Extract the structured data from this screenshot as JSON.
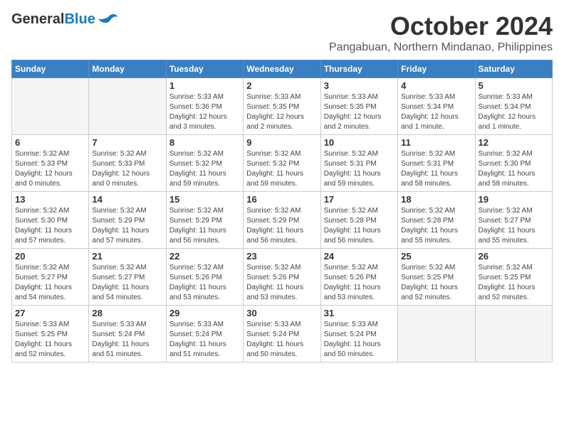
{
  "logo": {
    "line1": "General",
    "line2": "Blue"
  },
  "title": "October 2024",
  "location": "Pangabuan, Northern Mindanao, Philippines",
  "headers": [
    "Sunday",
    "Monday",
    "Tuesday",
    "Wednesday",
    "Thursday",
    "Friday",
    "Saturday"
  ],
  "weeks": [
    [
      {
        "day": "",
        "info": ""
      },
      {
        "day": "",
        "info": ""
      },
      {
        "day": "1",
        "info": "Sunrise: 5:33 AM\nSunset: 5:36 PM\nDaylight: 12 hours\nand 3 minutes."
      },
      {
        "day": "2",
        "info": "Sunrise: 5:33 AM\nSunset: 5:35 PM\nDaylight: 12 hours\nand 2 minutes."
      },
      {
        "day": "3",
        "info": "Sunrise: 5:33 AM\nSunset: 5:35 PM\nDaylight: 12 hours\nand 2 minutes."
      },
      {
        "day": "4",
        "info": "Sunrise: 5:33 AM\nSunset: 5:34 PM\nDaylight: 12 hours\nand 1 minute."
      },
      {
        "day": "5",
        "info": "Sunrise: 5:33 AM\nSunset: 5:34 PM\nDaylight: 12 hours\nand 1 minute."
      }
    ],
    [
      {
        "day": "6",
        "info": "Sunrise: 5:32 AM\nSunset: 5:33 PM\nDaylight: 12 hours\nand 0 minutes."
      },
      {
        "day": "7",
        "info": "Sunrise: 5:32 AM\nSunset: 5:33 PM\nDaylight: 12 hours\nand 0 minutes."
      },
      {
        "day": "8",
        "info": "Sunrise: 5:32 AM\nSunset: 5:32 PM\nDaylight: 11 hours\nand 59 minutes."
      },
      {
        "day": "9",
        "info": "Sunrise: 5:32 AM\nSunset: 5:32 PM\nDaylight: 11 hours\nand 59 minutes."
      },
      {
        "day": "10",
        "info": "Sunrise: 5:32 AM\nSunset: 5:31 PM\nDaylight: 11 hours\nand 59 minutes."
      },
      {
        "day": "11",
        "info": "Sunrise: 5:32 AM\nSunset: 5:31 PM\nDaylight: 11 hours\nand 58 minutes."
      },
      {
        "day": "12",
        "info": "Sunrise: 5:32 AM\nSunset: 5:30 PM\nDaylight: 11 hours\nand 58 minutes."
      }
    ],
    [
      {
        "day": "13",
        "info": "Sunrise: 5:32 AM\nSunset: 5:30 PM\nDaylight: 11 hours\nand 57 minutes."
      },
      {
        "day": "14",
        "info": "Sunrise: 5:32 AM\nSunset: 5:29 PM\nDaylight: 11 hours\nand 57 minutes."
      },
      {
        "day": "15",
        "info": "Sunrise: 5:32 AM\nSunset: 5:29 PM\nDaylight: 11 hours\nand 56 minutes."
      },
      {
        "day": "16",
        "info": "Sunrise: 5:32 AM\nSunset: 5:29 PM\nDaylight: 11 hours\nand 56 minutes."
      },
      {
        "day": "17",
        "info": "Sunrise: 5:32 AM\nSunset: 5:28 PM\nDaylight: 11 hours\nand 56 minutes."
      },
      {
        "day": "18",
        "info": "Sunrise: 5:32 AM\nSunset: 5:28 PM\nDaylight: 11 hours\nand 55 minutes."
      },
      {
        "day": "19",
        "info": "Sunrise: 5:32 AM\nSunset: 5:27 PM\nDaylight: 11 hours\nand 55 minutes."
      }
    ],
    [
      {
        "day": "20",
        "info": "Sunrise: 5:32 AM\nSunset: 5:27 PM\nDaylight: 11 hours\nand 54 minutes."
      },
      {
        "day": "21",
        "info": "Sunrise: 5:32 AM\nSunset: 5:27 PM\nDaylight: 11 hours\nand 54 minutes."
      },
      {
        "day": "22",
        "info": "Sunrise: 5:32 AM\nSunset: 5:26 PM\nDaylight: 11 hours\nand 53 minutes."
      },
      {
        "day": "23",
        "info": "Sunrise: 5:32 AM\nSunset: 5:26 PM\nDaylight: 11 hours\nand 53 minutes."
      },
      {
        "day": "24",
        "info": "Sunrise: 5:32 AM\nSunset: 5:26 PM\nDaylight: 11 hours\nand 53 minutes."
      },
      {
        "day": "25",
        "info": "Sunrise: 5:32 AM\nSunset: 5:25 PM\nDaylight: 11 hours\nand 52 minutes."
      },
      {
        "day": "26",
        "info": "Sunrise: 5:32 AM\nSunset: 5:25 PM\nDaylight: 11 hours\nand 52 minutes."
      }
    ],
    [
      {
        "day": "27",
        "info": "Sunrise: 5:33 AM\nSunset: 5:25 PM\nDaylight: 11 hours\nand 52 minutes."
      },
      {
        "day": "28",
        "info": "Sunrise: 5:33 AM\nSunset: 5:24 PM\nDaylight: 11 hours\nand 51 minutes."
      },
      {
        "day": "29",
        "info": "Sunrise: 5:33 AM\nSunset: 5:24 PM\nDaylight: 11 hours\nand 51 minutes."
      },
      {
        "day": "30",
        "info": "Sunrise: 5:33 AM\nSunset: 5:24 PM\nDaylight: 11 hours\nand 50 minutes."
      },
      {
        "day": "31",
        "info": "Sunrise: 5:33 AM\nSunset: 5:24 PM\nDaylight: 11 hours\nand 50 minutes."
      },
      {
        "day": "",
        "info": ""
      },
      {
        "day": "",
        "info": ""
      }
    ]
  ]
}
